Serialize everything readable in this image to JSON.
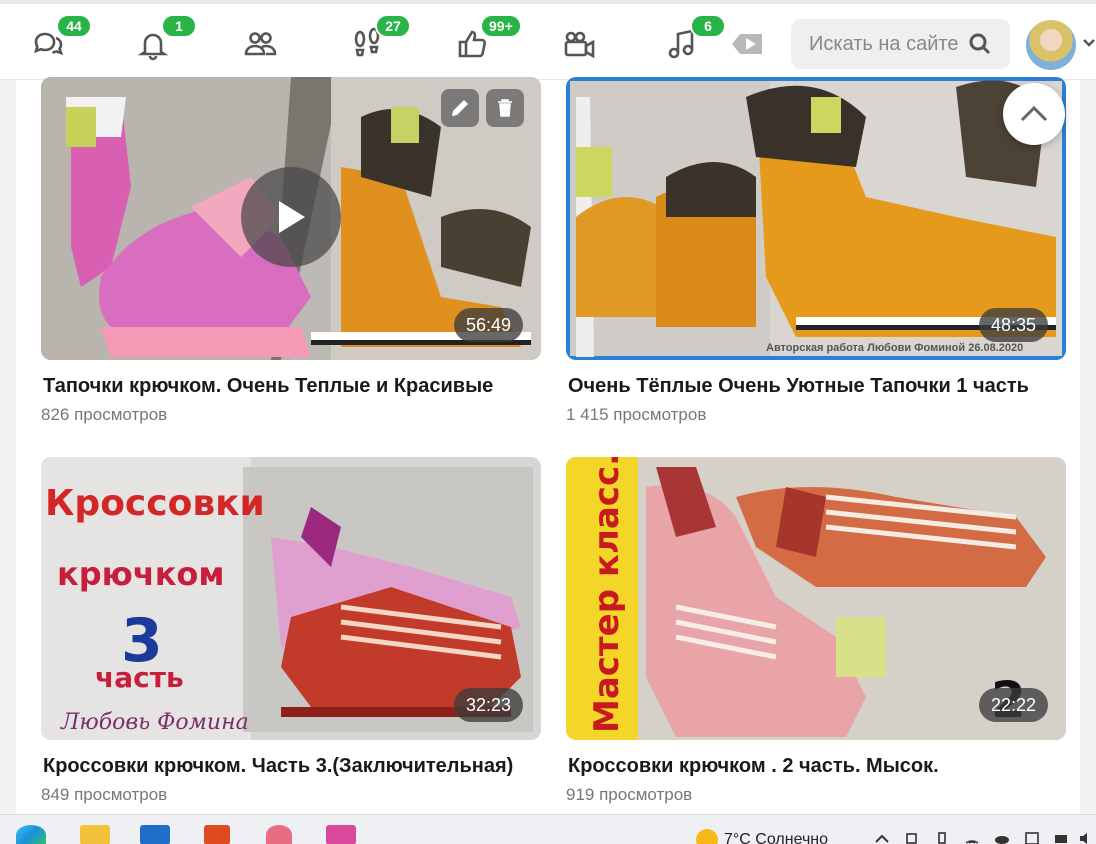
{
  "nav": {
    "items": [
      {
        "icon": "messages-icon",
        "badge": "44"
      },
      {
        "icon": "bell-icon",
        "badge": "1"
      },
      {
        "icon": "friends-icon",
        "badge": ""
      },
      {
        "icon": "footprints-icon",
        "badge": "27"
      },
      {
        "icon": "thumbs-up-icon",
        "badge": "99+"
      },
      {
        "icon": "video-camera-icon",
        "badge": ""
      },
      {
        "icon": "music-note-icon",
        "badge": "6"
      },
      {
        "icon": "play-video-icon",
        "badge": ""
      }
    ],
    "search_placeholder": "Искать на сайте"
  },
  "videos": [
    {
      "title": "Тапочки крючком. Очень Теплые и Красивые",
      "views": "826 просмотров",
      "duration": "56:49"
    },
    {
      "title": "Очень Тёплые Очень Уютные Тапочки 1 часть",
      "views": "1 415 просмотров",
      "duration": "48:35",
      "caption": "Авторская работа Любови Фоминой 26.08.2020"
    },
    {
      "title": "Кроссовки крючком. Часть 3.(Заключительная)",
      "views": "849 просмотров",
      "duration": "32:23",
      "overlay": {
        "line1": "Кроссовки",
        "line2": "крючком",
        "line3": "3",
        "line4": "часть",
        "signature": "Любовь Фомина"
      }
    },
    {
      "title": "Кроссовки крючком . 2 часть. Мысок.",
      "views": "919 просмотров",
      "duration": "22:22",
      "overlay": {
        "vertical": "Мастер класс.",
        "number": "2"
      }
    }
  ],
  "taskbar": {
    "weather": "7°C  Солнечно"
  }
}
